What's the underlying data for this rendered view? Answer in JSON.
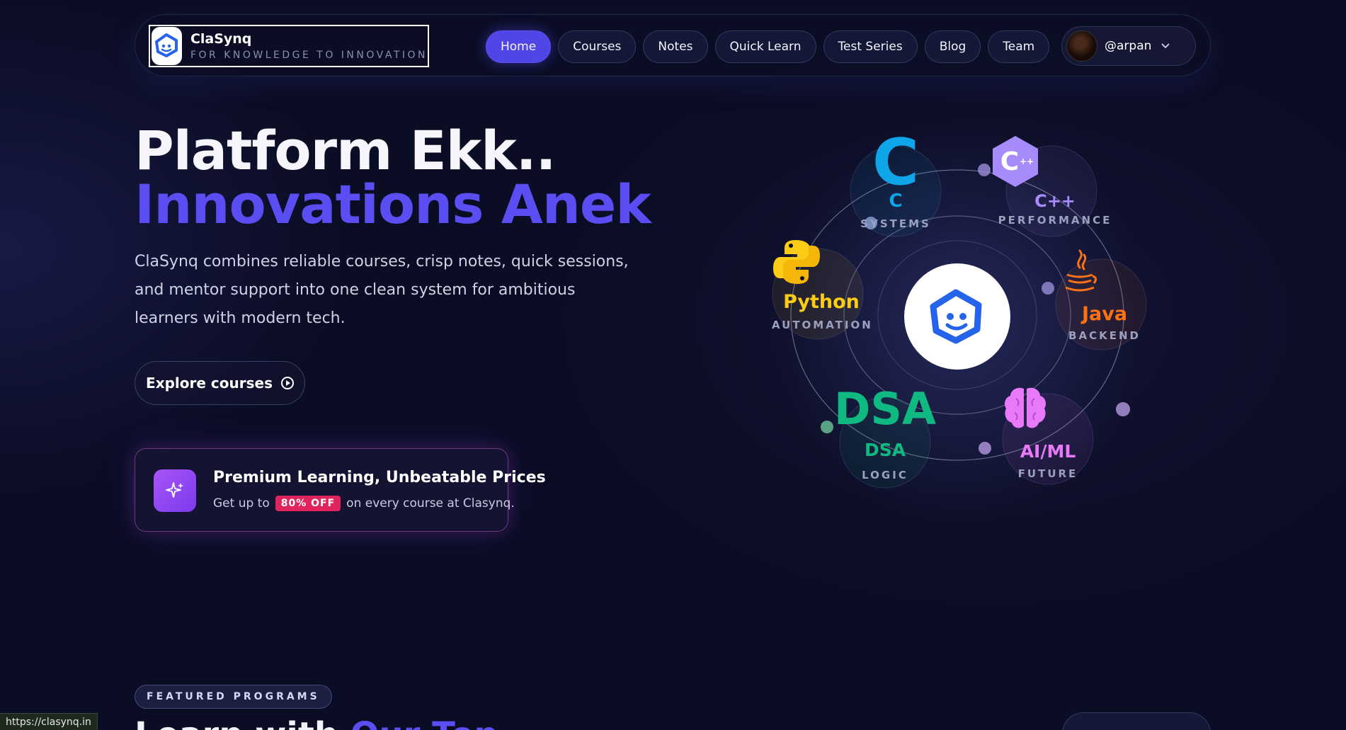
{
  "nav": {
    "brand_name": "ClaSynq",
    "brand_tagline": "FOR KNOWLEDGE TO INNOVATION",
    "links": [
      "Home",
      "Courses",
      "Notes",
      "Quick Learn",
      "Test Series",
      "Blog",
      "Team"
    ],
    "active_link": "Home",
    "user": "@arpan"
  },
  "hero": {
    "title_line1": "Platform Ekk..",
    "title_line2": "Innovations Anek",
    "description": "ClaSynq combines reliable courses, crisp notes, quick sessions, and mentor support into one clean system for ambitious learners with modern tech.",
    "explore_label": "Explore courses"
  },
  "promo": {
    "title": "Premium Learning, Unbeatable Prices",
    "prefix": "Get up to",
    "badge": "80% OFF",
    "suffix": "on every course at Clasynq."
  },
  "orbit": {
    "nodes": [
      {
        "logo": "C",
        "label": "C",
        "sub": "SYSTEMS",
        "color": "#0ea5e9"
      },
      {
        "logo": "C++",
        "label": "C++",
        "sub": "PERFORMANCE",
        "color": "#a78bfa"
      },
      {
        "logo": "python",
        "label": "Python",
        "sub": "AUTOMATION",
        "color": "#facc15"
      },
      {
        "logo": "java",
        "label": "Java",
        "sub": "BACKEND",
        "color": "#f97316"
      },
      {
        "logo": "DSA",
        "label": "DSA",
        "sub": "LOGIC",
        "color": "#10b981"
      },
      {
        "logo": "brain",
        "label": "AI/ML",
        "sub": "FUTURE",
        "color": "#e879f9"
      }
    ]
  },
  "featured": {
    "badge": "FEATURED PROGRAMS",
    "heading_start": "Learn with",
    "heading_accent": "Our Top"
  },
  "status_url": "https://clasynq.in",
  "colors": {
    "accent": "#5a4df2",
    "nav_active": "#4f46e5",
    "promo_badge": "#e0245e"
  }
}
